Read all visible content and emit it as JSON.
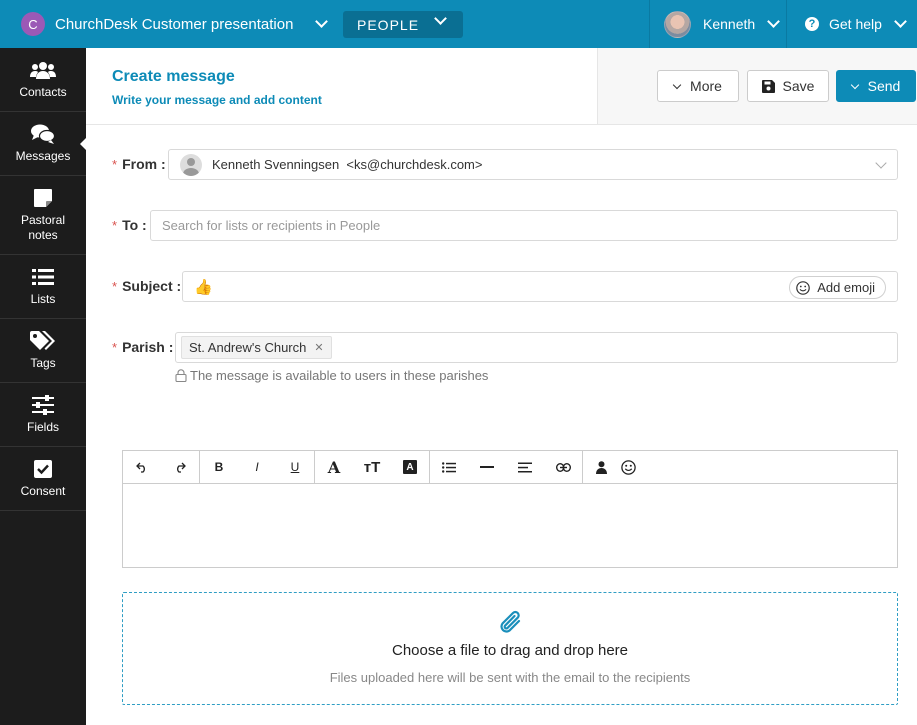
{
  "topbar": {
    "org_initial": "C",
    "org_name": "ChurchDesk Customer presentation",
    "module": "PEOPLE",
    "user_name": "Kenneth",
    "help_label": "Get help"
  },
  "sidebar": {
    "items": [
      {
        "label": "Contacts",
        "icon": "contacts-icon"
      },
      {
        "label": "Messages",
        "icon": "messages-icon",
        "active": true
      },
      {
        "label": "Pastoral notes",
        "icon": "note-icon"
      },
      {
        "label": "Lists",
        "icon": "list-icon"
      },
      {
        "label": "Tags",
        "icon": "tags-icon"
      },
      {
        "label": "Fields",
        "icon": "sliders-icon"
      },
      {
        "label": "Consent",
        "icon": "checkbox-icon"
      }
    ]
  },
  "header": {
    "title": "Create message",
    "subtitle": "Write your message and add content",
    "more_label": "More",
    "save_label": "Save",
    "send_label": "Send"
  },
  "form": {
    "from_label": "From :",
    "from_value": "Kenneth Svenningsen  <ks@churchdesk.com>",
    "to_label": "To :",
    "to_placeholder": "Search for lists or recipients in People",
    "subject_label": "Subject :",
    "subject_value": "👍",
    "add_emoji_label": "Add emoji",
    "parish_label": "Parish :",
    "parish_tag": "St. Andrew's Church",
    "parish_hint": "The message is available to users in these parishes"
  },
  "dropzone": {
    "title": "Choose a file to drag and drop here",
    "subtitle": "Files uploaded here will be sent with the email to the recipients"
  },
  "colors": {
    "brand": "#0d8bb7",
    "sidebar": "#1c1c1c",
    "required": "#d9534f"
  }
}
